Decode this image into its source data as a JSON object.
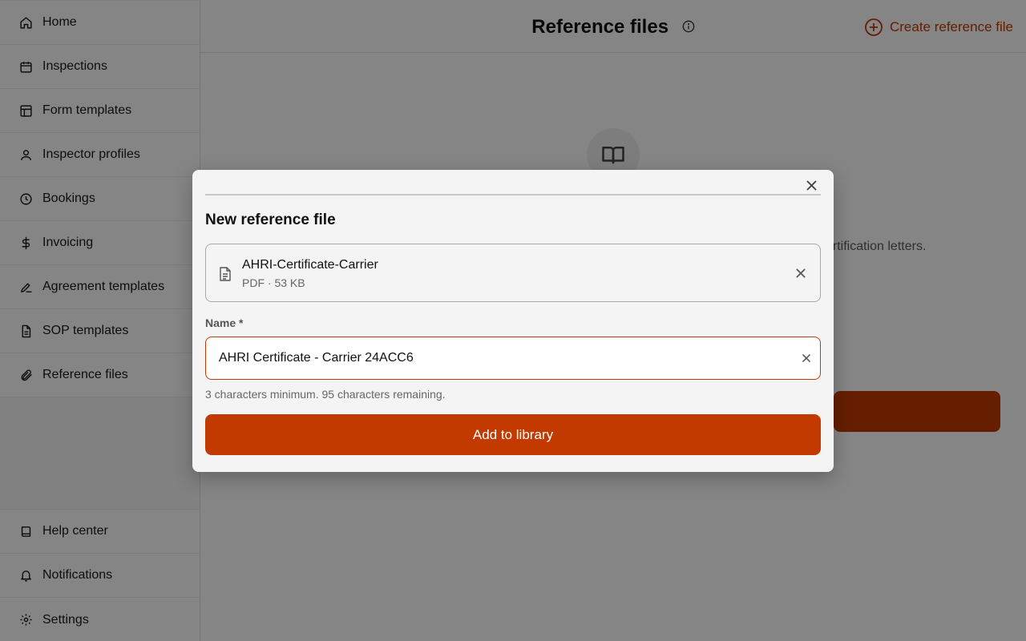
{
  "sidebar": {
    "items": [
      {
        "label": "Home",
        "icon": "home-icon"
      },
      {
        "label": "Inspections",
        "icon": "calendar-icon"
      },
      {
        "label": "Form templates",
        "icon": "layout-icon"
      },
      {
        "label": "Inspector profiles",
        "icon": "user-icon"
      },
      {
        "label": "Bookings",
        "icon": "clock-icon"
      },
      {
        "label": "Invoicing",
        "icon": "dollar-icon"
      },
      {
        "label": "Agreement templates",
        "icon": "signature-icon"
      },
      {
        "label": "SOP templates",
        "icon": "document-icon"
      },
      {
        "label": "Reference files",
        "icon": "paperclip-icon"
      }
    ],
    "bottom_items": [
      {
        "label": "Help center",
        "icon": "book-icon"
      },
      {
        "label": "Notifications",
        "icon": "bell-icon"
      },
      {
        "label": "Settings",
        "icon": "gear-icon"
      }
    ]
  },
  "header": {
    "title": "Reference files",
    "create_label": "Create reference file"
  },
  "empty_state": {
    "description_fragment": "ertification letters."
  },
  "modal": {
    "title": "New reference file",
    "file": {
      "name": "AHRI-Certificate-Carrier",
      "meta": "PDF · 53 KB"
    },
    "name_label": "Name *",
    "name_value": "AHRI Certificate - Carrier 24ACC6",
    "helper": "3 characters minimum. 95 characters remaining.",
    "submit_label": "Add to library"
  },
  "colors": {
    "accent": "#c23a00",
    "overlay": "rgba(0,0,0,0.48)"
  }
}
